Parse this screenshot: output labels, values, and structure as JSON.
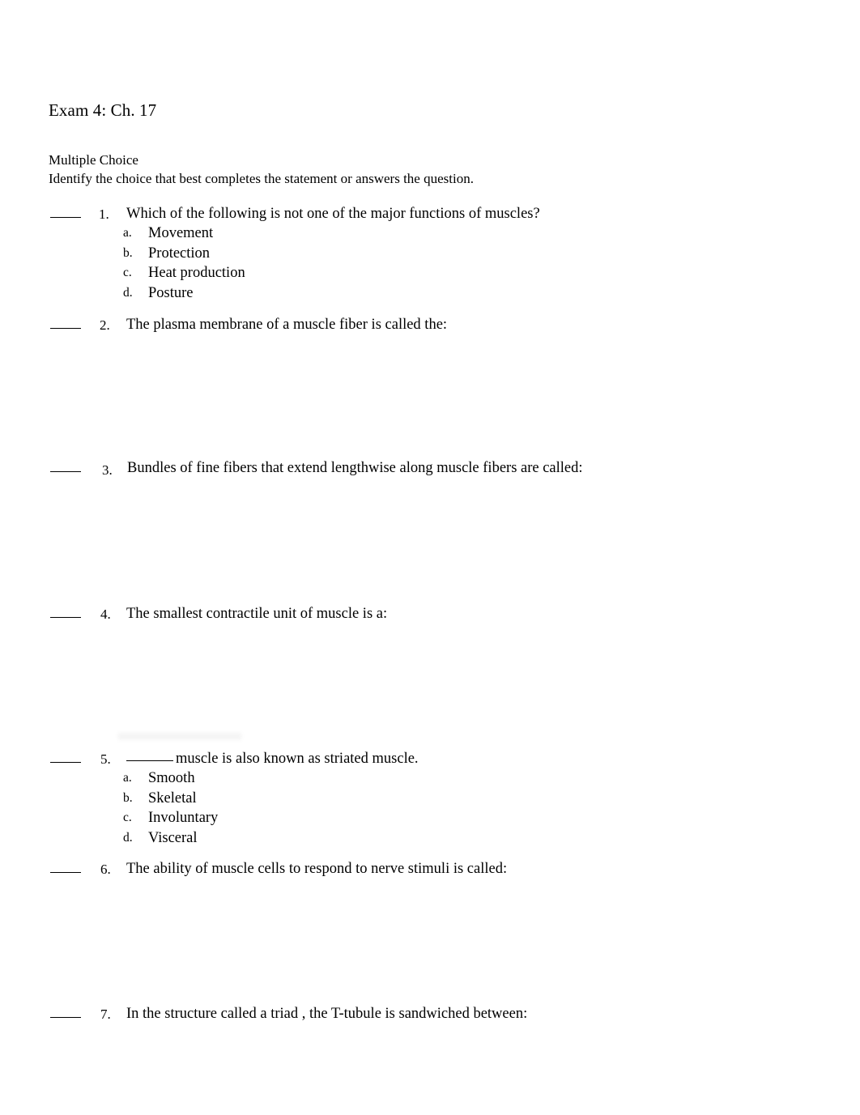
{
  "document": {
    "title": "Exam 4: Ch. 17",
    "instructions": {
      "heading": "Multiple Choice",
      "line": "Identify the choice that best completes the statement or answers the question."
    }
  },
  "questions": [
    {
      "number": "1.",
      "text": "Which of the following is not one of the major functions of muscles?",
      "options": [
        {
          "letter": "a.",
          "text": "Movement"
        },
        {
          "letter": "b.",
          "text": "Protection"
        },
        {
          "letter": "c.",
          "text": "Heat production"
        },
        {
          "letter": "d.",
          "text": "Posture"
        }
      ]
    },
    {
      "number": "2.",
      "text": "The plasma membrane of a muscle fiber is called the:",
      "options": []
    },
    {
      "number": "3.",
      "text": "Bundles of fine fibers that extend lengthwise along muscle fibers are called:",
      "options": []
    },
    {
      "number": "4.",
      "text": "The smallest contractile unit of muscle is a:",
      "options": []
    },
    {
      "number": "5.",
      "text_before_blank": "",
      "text_after_blank": "muscle is also known as striated muscle.",
      "options": [
        {
          "letter": "a.",
          "text": "Smooth"
        },
        {
          "letter": "b.",
          "text": "Skeletal"
        },
        {
          "letter": "c.",
          "text": "Involuntary"
        },
        {
          "letter": "d.",
          "text": "Visceral"
        }
      ]
    },
    {
      "number": "6.",
      "text": "The ability of muscle cells to respond to nerve stimuli is called:",
      "options": []
    },
    {
      "number": "7.",
      "text": "In the structure called a triad , the T-tubule is sandwiched between:",
      "options": []
    }
  ]
}
